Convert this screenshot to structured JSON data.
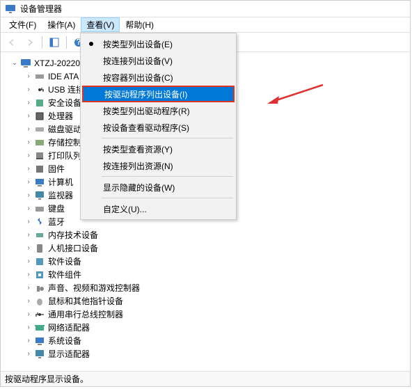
{
  "window": {
    "title": "设备管理器"
  },
  "menubar": {
    "file": "文件(F)",
    "action": "操作(A)",
    "view": "查看(V)",
    "help": "帮助(H)"
  },
  "dropdown": {
    "items": [
      {
        "label": "按类型列出设备(E)",
        "bullet": true
      },
      {
        "label": "按连接列出设备(V)"
      },
      {
        "label": "按容器列出设备(C)"
      },
      {
        "label": "按驱动程序列出设备(I)",
        "selected": true
      },
      {
        "label": "按类型列出驱动程序(R)"
      },
      {
        "label": "按设备查看驱动程序(S)"
      },
      {
        "sep": true
      },
      {
        "label": "按类型查看资源(Y)"
      },
      {
        "label": "按连接列出资源(N)"
      },
      {
        "sep": true
      },
      {
        "label": "显示隐藏的设备(W)"
      },
      {
        "sep": true
      },
      {
        "label": "自定义(U)..."
      }
    ]
  },
  "tree": {
    "root": "XTZJ-20220",
    "children": [
      "IDE ATA",
      "USB 连接",
      "安全设备",
      "处理器",
      "磁盘驱动",
      "存储控制",
      "打印队列",
      "固件",
      "计算机",
      "监视器",
      "键盘",
      "蓝牙",
      "内存技术设备",
      "人机接口设备",
      "软件设备",
      "软件组件",
      "声音、视频和游戏控制器",
      "鼠标和其他指针设备",
      "通用串行总线控制器",
      "网络适配器",
      "系统设备",
      "显示适配器"
    ]
  },
  "statusbar": {
    "text": "按驱动程序显示设备。"
  },
  "annotation": {
    "arrow_color": "#e03030"
  },
  "icons": {
    "root": "monitor-icon",
    "child_default": "device-icon"
  }
}
